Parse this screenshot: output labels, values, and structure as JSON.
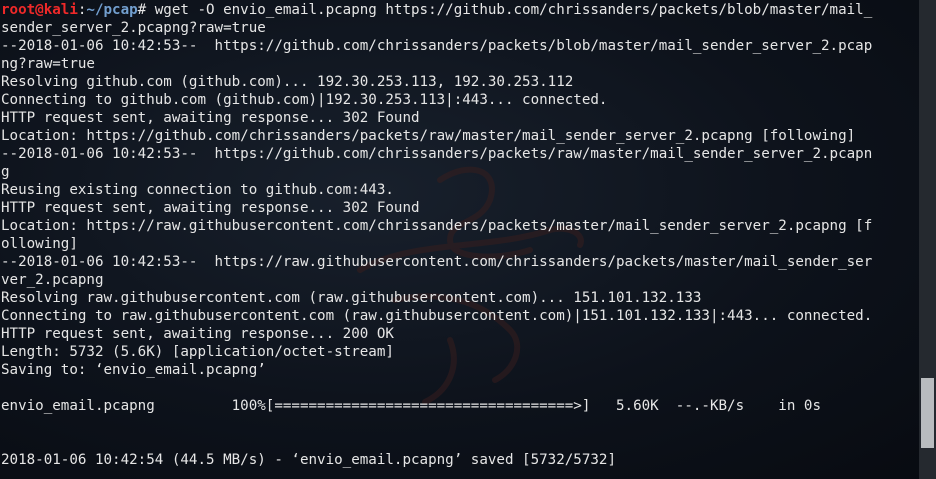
{
  "prompt": {
    "user_host": "root@kali",
    "colon": ":",
    "cwd": "~/pcap",
    "symbol": "# "
  },
  "terminal": {
    "lines": [
      "wget -O envio_email.pcapng https://github.com/chrissanders/packets/blob/master/mail_",
      "sender_server_2.pcapng?raw=true",
      "--2018-01-06 10:42:53--  https://github.com/chrissanders/packets/blob/master/mail_sender_server_2.pcap",
      "ng?raw=true",
      "Resolving github.com (github.com)... 192.30.253.113, 192.30.253.112",
      "Connecting to github.com (github.com)|192.30.253.113|:443... connected.",
      "HTTP request sent, awaiting response... 302 Found",
      "Location: https://github.com/chrissanders/packets/raw/master/mail_sender_server_2.pcapng [following]",
      "--2018-01-06 10:42:53--  https://github.com/chrissanders/packets/raw/master/mail_sender_server_2.pcapn",
      "g",
      "Reusing existing connection to github.com:443.",
      "HTTP request sent, awaiting response... 302 Found",
      "Location: https://raw.githubusercontent.com/chrissanders/packets/master/mail_sender_server_2.pcapng [f",
      "ollowing]",
      "--2018-01-06 10:42:53--  https://raw.githubusercontent.com/chrissanders/packets/master/mail_sender_ser",
      "ver_2.pcapng",
      "Resolving raw.githubusercontent.com (raw.githubusercontent.com)... 151.101.132.133",
      "Connecting to raw.githubusercontent.com (raw.githubusercontent.com)|151.101.132.133|:443... connected.",
      "HTTP request sent, awaiting response... 200 OK",
      "Length: 5732 (5.6K) [application/octet-stream]",
      "Saving to: ‘envio_email.pcapng’",
      "",
      "envio_email.pcapng         100%[===================================>]   5.60K  --.-KB/s    in 0s",
      "",
      "",
      "2018-01-06 10:42:54 (44.5 MB/s) - ‘envio_email.pcapng’ saved [5732/5732]"
    ]
  },
  "colors": {
    "background": "#0d121b",
    "text": "#e6e6e6",
    "prompt_user": "#ef2929",
    "prompt_path": "#729fcf",
    "scrollbar_track": "#25292f",
    "scrollbar_thumb": "#b9bcbf"
  },
  "watermark": "kali-dragon-icon"
}
